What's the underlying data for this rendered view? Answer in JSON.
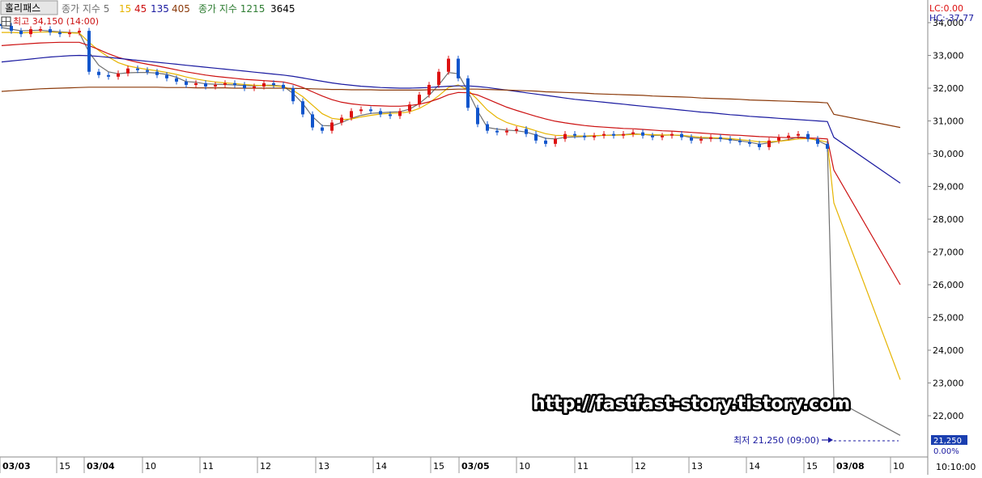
{
  "header": {
    "symbol_label": "홀리패스",
    "legend_ma_label": "종가 지수 5",
    "ma_periods": [
      "15",
      "45",
      "135",
      "405"
    ],
    "legend_ma2_label": "종가 지수 1215",
    "ma2_extra": "3645",
    "high_label": "최고 34,150 (14:00)"
  },
  "right_panel": {
    "lc": "LC:0.00",
    "hc": "HC:-37.77",
    "current_price": "21,250",
    "current_pct": "0.00%",
    "time_label": "10:10:00"
  },
  "watermark": "http://fastfast-story.tistory.com",
  "low_label": "최저 21,250 (09:00)",
  "colors": {
    "ma5": "#707070",
    "ma15": "#e6b400",
    "ma45": "#cc1111",
    "ma135": "#1a1aa0",
    "ma405": "#8b3a0a",
    "ma1215": "#2e7d32",
    "up_candle": "#dd1111",
    "down_candle": "#1155cc"
  },
  "chart_data": {
    "type": "line",
    "y_axis": {
      "ticks": [
        "34,000",
        "33,000",
        "32,000",
        "31,000",
        "30,000",
        "29,000",
        "28,000",
        "27,000",
        "26,000",
        "25,000",
        "24,000",
        "23,000",
        "22,000"
      ],
      "ylim": [
        21000,
        34300
      ]
    },
    "x_axis": {
      "ticks": [
        {
          "label": "03/03",
          "bold": true
        },
        {
          "label": "15",
          "bold": false
        },
        {
          "label": "03/04",
          "bold": true
        },
        {
          "label": "10",
          "bold": false
        },
        {
          "label": "11",
          "bold": false
        },
        {
          "label": "12",
          "bold": false
        },
        {
          "label": "13",
          "bold": false
        },
        {
          "label": "14",
          "bold": false
        },
        {
          "label": "15",
          "bold": false
        },
        {
          "label": "03/05",
          "bold": true
        },
        {
          "label": "10",
          "bold": false
        },
        {
          "label": "11",
          "bold": false
        },
        {
          "label": "12",
          "bold": false
        },
        {
          "label": "13",
          "bold": false
        },
        {
          "label": "14",
          "bold": false
        },
        {
          "label": "15",
          "bold": false
        },
        {
          "label": "03/08",
          "bold": true
        },
        {
          "label": "10",
          "bold": false
        }
      ]
    },
    "price_series_close": [
      33900,
      33750,
      33650,
      33800,
      33800,
      33700,
      33650,
      33700,
      33750,
      32500,
      32400,
      32350,
      32450,
      32600,
      32550,
      32500,
      32400,
      32300,
      32200,
      32100,
      32150,
      32050,
      32100,
      32150,
      32100,
      32000,
      32050,
      32150,
      32100,
      32000,
      31600,
      31200,
      30800,
      30700,
      30950,
      31100,
      31300,
      31350,
      31300,
      31200,
      31150,
      31300,
      31500,
      31800,
      32100,
      32500,
      32900,
      32300,
      31400,
      30900,
      30700,
      30650,
      30700,
      30750,
      30600,
      30400,
      30300,
      30450,
      30600,
      30550,
      30500,
      30550,
      30600,
      30550,
      30600,
      30650,
      30550,
      30500,
      30550,
      30600,
      30500,
      30400,
      30450,
      30500,
      30450,
      30400,
      30350,
      30300,
      30200,
      30400,
      30500,
      30550,
      30600,
      30450,
      30300,
      30150,
      21250
    ],
    "series": [
      {
        "name": "5",
        "values": [
          33850,
          33800,
          33750,
          33760,
          33770,
          33740,
          33720,
          33700,
          33690,
          33100,
          32700,
          32500,
          32440,
          32470,
          32480,
          32480,
          32460,
          32420,
          32330,
          32200,
          32180,
          32130,
          32120,
          32110,
          32100,
          32080,
          32070,
          32090,
          32090,
          32060,
          31840,
          31530,
          31130,
          30860,
          30850,
          30950,
          31080,
          31170,
          31230,
          31250,
          31270,
          31280,
          31360,
          31530,
          31780,
          32100,
          32480,
          32440,
          31900,
          31300,
          30800,
          30750,
          30720,
          30700,
          30660,
          30570,
          30470,
          30450,
          30500,
          30510,
          30520,
          30540,
          30560,
          30570,
          30580,
          30610,
          30590,
          30560,
          30560,
          30570,
          30550,
          30490,
          30470,
          30470,
          30460,
          30430,
          30390,
          30350,
          30290,
          30330,
          30380,
          30430,
          30510,
          30490,
          30400,
          30260,
          22500,
          21400
        ]
      },
      {
        "name": "15",
        "values": [
          33700,
          33700,
          33690,
          33700,
          33710,
          33710,
          33700,
          33690,
          33680,
          33400,
          33150,
          32950,
          32780,
          32680,
          32620,
          32570,
          32530,
          32480,
          32420,
          32340,
          32280,
          32230,
          32190,
          32160,
          32140,
          32110,
          32090,
          32080,
          32070,
          32050,
          31930,
          31740,
          31480,
          31220,
          31080,
          31040,
          31060,
          31120,
          31170,
          31210,
          31230,
          31240,
          31280,
          31380,
          31550,
          31770,
          32020,
          32100,
          31940,
          31650,
          31330,
          31100,
          30950,
          30860,
          30790,
          30700,
          30610,
          30560,
          30550,
          30540,
          30540,
          30550,
          30560,
          30560,
          30570,
          30590,
          30590,
          30580,
          30570,
          30570,
          30560,
          30530,
          30500,
          30490,
          30480,
          30460,
          30430,
          30400,
          30360,
          30360,
          30380,
          30410,
          30450,
          30460,
          30420,
          30350,
          28500,
          23100
        ]
      },
      {
        "name": "45",
        "values": [
          33300,
          33320,
          33340,
          33360,
          33380,
          33390,
          33400,
          33400,
          33400,
          33300,
          33180,
          33050,
          32940,
          32860,
          32790,
          32730,
          32680,
          32620,
          32560,
          32500,
          32450,
          32400,
          32360,
          32330,
          32300,
          32270,
          32250,
          32230,
          32210,
          32190,
          32120,
          32020,
          31890,
          31760,
          31650,
          31570,
          31520,
          31490,
          31470,
          31460,
          31450,
          31450,
          31470,
          31510,
          31580,
          31680,
          31800,
          31870,
          31860,
          31790,
          31670,
          31540,
          31420,
          31320,
          31230,
          31140,
          31060,
          30990,
          30940,
          30900,
          30860,
          30830,
          30810,
          30790,
          30770,
          30760,
          30740,
          30720,
          30700,
          30690,
          30670,
          30650,
          30630,
          30610,
          30590,
          30570,
          30560,
          30540,
          30520,
          30510,
          30500,
          30490,
          30490,
          30480,
          30470,
          30450,
          29500,
          26000
        ]
      },
      {
        "name": "135",
        "values": [
          32800,
          32830,
          32860,
          32890,
          32920,
          32950,
          32970,
          32990,
          33000,
          32990,
          32970,
          32940,
          32910,
          32880,
          32850,
          32820,
          32790,
          32760,
          32730,
          32700,
          32670,
          32640,
          32610,
          32580,
          32550,
          32520,
          32490,
          32460,
          32430,
          32400,
          32360,
          32310,
          32260,
          32210,
          32160,
          32120,
          32090,
          32060,
          32040,
          32020,
          32010,
          32000,
          32000,
          32010,
          32020,
          32040,
          32060,
          32070,
          32070,
          32050,
          32020,
          31980,
          31940,
          31900,
          31860,
          31820,
          31780,
          31740,
          31700,
          31660,
          31630,
          31600,
          31570,
          31540,
          31510,
          31480,
          31450,
          31420,
          31390,
          31360,
          31330,
          31300,
          31270,
          31250,
          31220,
          31190,
          31170,
          31140,
          31120,
          31100,
          31080,
          31060,
          31040,
          31020,
          31000,
          30980,
          30500,
          29100
        ]
      },
      {
        "name": "405",
        "values": [
          31900,
          31920,
          31940,
          31960,
          31980,
          31990,
          32000,
          32010,
          32020,
          32030,
          32030,
          32030,
          32030,
          32030,
          32030,
          32030,
          32030,
          32020,
          32020,
          32020,
          32010,
          32010,
          32010,
          32010,
          32000,
          32000,
          32000,
          32000,
          32000,
          32000,
          31990,
          31990,
          31980,
          31970,
          31960,
          31960,
          31950,
          31950,
          31950,
          31940,
          31940,
          31940,
          31940,
          31940,
          31950,
          31950,
          31960,
          31970,
          31970,
          31970,
          31960,
          31950,
          31940,
          31930,
          31920,
          31910,
          31890,
          31880,
          31870,
          31860,
          31850,
          31830,
          31820,
          31810,
          31800,
          31790,
          31780,
          31760,
          31750,
          31740,
          31730,
          31720,
          31700,
          31690,
          31680,
          31670,
          31660,
          31640,
          31630,
          31620,
          31610,
          31600,
          31590,
          31580,
          31570,
          31550,
          31200,
          30800
        ]
      }
    ]
  }
}
